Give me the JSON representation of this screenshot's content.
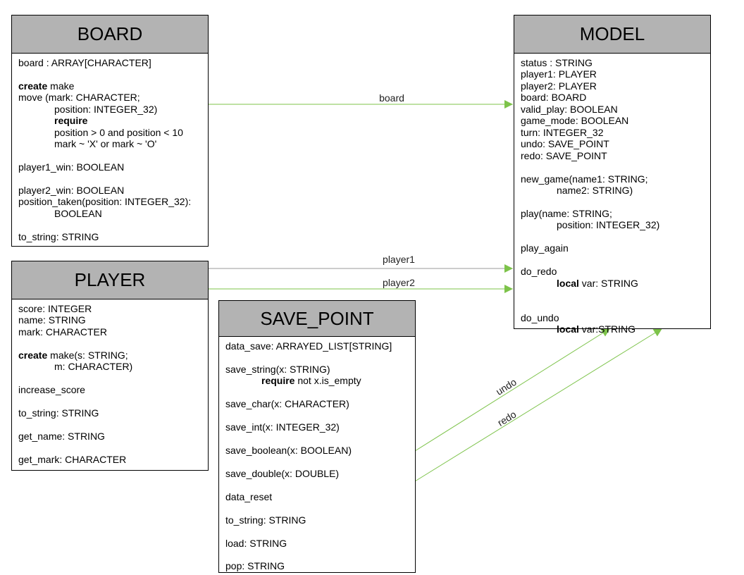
{
  "classes": {
    "board": {
      "title": "BOARD",
      "lines": [
        {
          "i": 0,
          "kw": "",
          "t": "board : ARRAY[CHARACTER]"
        },
        {
          "i": 0,
          "kw": "",
          "t": ""
        },
        {
          "i": 0,
          "kw": "create",
          "t": " make"
        },
        {
          "i": 0,
          "kw": "",
          "t": "move (mark: CHARACTER;"
        },
        {
          "i": 1,
          "kw": "",
          "t": "position: INTEGER_32)"
        },
        {
          "i": 1,
          "kw": "require",
          "t": ""
        },
        {
          "i": 1,
          "kw": "",
          "t": "position > 0 and position < 10"
        },
        {
          "i": 1,
          "kw": "",
          "t": "mark ~ 'X' or mark ~ 'O'"
        },
        {
          "i": 0,
          "kw": "",
          "t": ""
        },
        {
          "i": 0,
          "kw": "",
          "t": "player1_win: BOOLEAN"
        },
        {
          "i": 0,
          "kw": "",
          "t": ""
        },
        {
          "i": 0,
          "kw": "",
          "t": "player2_win: BOOLEAN"
        },
        {
          "i": 0,
          "kw": "",
          "t": "position_taken(position: INTEGER_32):"
        },
        {
          "i": 1,
          "kw": "",
          "t": "BOOLEAN"
        },
        {
          "i": 0,
          "kw": "",
          "t": ""
        },
        {
          "i": 0,
          "kw": "",
          "t": "to_string: STRING"
        }
      ]
    },
    "player": {
      "title": "PLAYER",
      "lines": [
        {
          "i": 0,
          "kw": "",
          "t": "score: INTEGER"
        },
        {
          "i": 0,
          "kw": "",
          "t": "name: STRING"
        },
        {
          "i": 0,
          "kw": "",
          "t": "mark: CHARACTER"
        },
        {
          "i": 0,
          "kw": "",
          "t": ""
        },
        {
          "i": 0,
          "kw": "create",
          "t": " make(s: STRING;"
        },
        {
          "i": 1,
          "kw": "",
          "t": "m: CHARACTER)"
        },
        {
          "i": 0,
          "kw": "",
          "t": ""
        },
        {
          "i": 0,
          "kw": "",
          "t": "increase_score"
        },
        {
          "i": 0,
          "kw": "",
          "t": ""
        },
        {
          "i": 0,
          "kw": "",
          "t": "to_string: STRING"
        },
        {
          "i": 0,
          "kw": "",
          "t": ""
        },
        {
          "i": 0,
          "kw": "",
          "t": "get_name: STRING"
        },
        {
          "i": 0,
          "kw": "",
          "t": ""
        },
        {
          "i": 0,
          "kw": "",
          "t": "get_mark: CHARACTER"
        }
      ]
    },
    "save_point": {
      "title": "SAVE_POINT",
      "lines": [
        {
          "i": 0,
          "kw": "",
          "t": "data_save: ARRAYED_LIST[STRING]"
        },
        {
          "i": 0,
          "kw": "",
          "t": ""
        },
        {
          "i": 0,
          "kw": "",
          "t": "save_string(x: STRING)"
        },
        {
          "i": 1,
          "kw": "require",
          "t": " not x.is_empty"
        },
        {
          "i": 0,
          "kw": "",
          "t": ""
        },
        {
          "i": 0,
          "kw": "",
          "t": "save_char(x: CHARACTER)"
        },
        {
          "i": 0,
          "kw": "",
          "t": ""
        },
        {
          "i": 0,
          "kw": "",
          "t": "save_int(x: INTEGER_32)"
        },
        {
          "i": 0,
          "kw": "",
          "t": ""
        },
        {
          "i": 0,
          "kw": "",
          "t": "save_boolean(x: BOOLEAN)"
        },
        {
          "i": 0,
          "kw": "",
          "t": ""
        },
        {
          "i": 0,
          "kw": "",
          "t": "save_double(x: DOUBLE)"
        },
        {
          "i": 0,
          "kw": "",
          "t": ""
        },
        {
          "i": 0,
          "kw": "",
          "t": "data_reset"
        },
        {
          "i": 0,
          "kw": "",
          "t": ""
        },
        {
          "i": 0,
          "kw": "",
          "t": "to_string: STRING"
        },
        {
          "i": 0,
          "kw": "",
          "t": ""
        },
        {
          "i": 0,
          "kw": "",
          "t": "load: STRING"
        },
        {
          "i": 0,
          "kw": "",
          "t": ""
        },
        {
          "i": 0,
          "kw": "",
          "t": "pop: STRING"
        }
      ]
    },
    "model": {
      "title": "MODEL",
      "lines": [
        {
          "i": 0,
          "kw": "",
          "t": "status : STRING"
        },
        {
          "i": 0,
          "kw": "",
          "t": "player1: PLAYER"
        },
        {
          "i": 0,
          "kw": "",
          "t": "player2: PLAYER"
        },
        {
          "i": 0,
          "kw": "",
          "t": "board: BOARD"
        },
        {
          "i": 0,
          "kw": "",
          "t": "valid_play: BOOLEAN"
        },
        {
          "i": 0,
          "kw": "",
          "t": "game_mode: BOOLEAN"
        },
        {
          "i": 0,
          "kw": "",
          "t": "turn: INTEGER_32"
        },
        {
          "i": 0,
          "kw": "",
          "t": "undo: SAVE_POINT"
        },
        {
          "i": 0,
          "kw": "",
          "t": "redo: SAVE_POINT"
        },
        {
          "i": 0,
          "kw": "",
          "t": ""
        },
        {
          "i": 0,
          "kw": "",
          "t": "new_game(name1: STRING;"
        },
        {
          "i": 1,
          "kw": "",
          "t": "name2: STRING)"
        },
        {
          "i": 0,
          "kw": "",
          "t": ""
        },
        {
          "i": 0,
          "kw": "",
          "t": "play(name: STRING;"
        },
        {
          "i": 1,
          "kw": "",
          "t": "position: INTEGER_32)"
        },
        {
          "i": 0,
          "kw": "",
          "t": ""
        },
        {
          "i": 0,
          "kw": "",
          "t": "play_again"
        },
        {
          "i": 0,
          "kw": "",
          "t": ""
        },
        {
          "i": 0,
          "kw": "",
          "t": "do_redo"
        },
        {
          "i": 1,
          "kw": "local",
          "t": " var: STRING"
        },
        {
          "i": 0,
          "kw": "",
          "t": ""
        },
        {
          "i": 0,
          "kw": "",
          "t": ""
        },
        {
          "i": 0,
          "kw": "",
          "t": "do_undo"
        },
        {
          "i": 1,
          "kw": "local",
          "t": " var:STRING"
        }
      ]
    }
  },
  "associations": {
    "board": "board",
    "player1": "player1",
    "player2": "player2",
    "undo": "undo",
    "redo": "redo"
  },
  "colors": {
    "arrow": "#7dc34a",
    "header": "#b3b3b3"
  }
}
